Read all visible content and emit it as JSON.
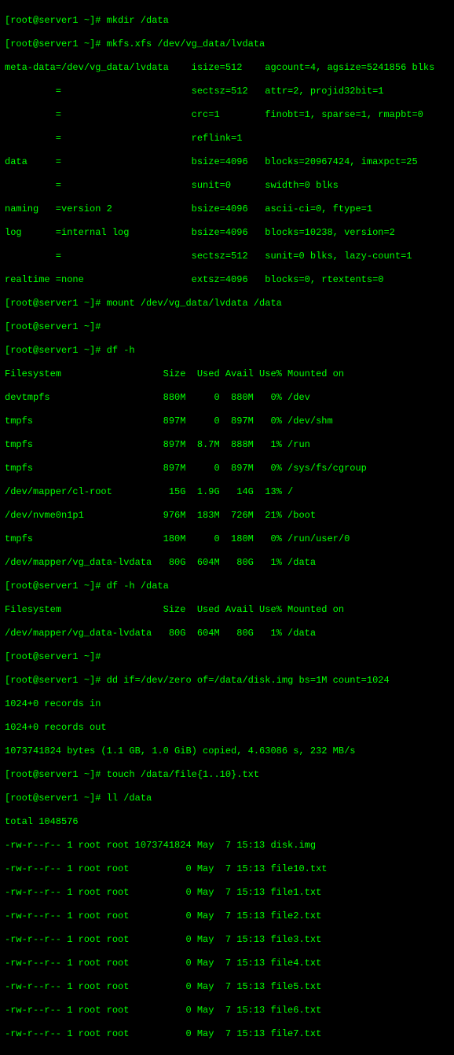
{
  "prompt": "[root@server1 ~]#",
  "cmds": {
    "mkdir": "mkdir /data",
    "mkfs": "mkfs.xfs /dev/vg_data/lvdata",
    "mount": "mount /dev/vg_data/lvdata /data",
    "dfh": "df -h",
    "dfh_data": "df -h /data",
    "dd": "dd if=/dev/zero of=/data/disk.img bs=1M count=1024",
    "touch": "touch /data/file{1..10}.txt",
    "ll": "ll /data"
  },
  "mkfs_out": [
    "meta-data=/dev/vg_data/lvdata    isize=512    agcount=4, agsize=5241856 blks",
    "         =                       sectsz=512   attr=2, projid32bit=1",
    "         =                       crc=1        finobt=1, sparse=1, rmapbt=0",
    "         =                       reflink=1",
    "data     =                       bsize=4096   blocks=20967424, imaxpct=25",
    "         =                       sunit=0      swidth=0 blks",
    "naming   =version 2              bsize=4096   ascii-ci=0, ftype=1",
    "log      =internal log           bsize=4096   blocks=10238, version=2",
    "         =                       sectsz=512   sunit=0 blks, lazy-count=1",
    "realtime =none                   extsz=4096   blocks=0, rtextents=0"
  ],
  "df_header": "Filesystem                  Size  Used Avail Use% Mounted on",
  "df_rows": [
    "devtmpfs                    880M     0  880M   0% /dev",
    "tmpfs                       897M     0  897M   0% /dev/shm",
    "tmpfs                       897M  8.7M  888M   1% /run",
    "tmpfs                       897M     0  897M   0% /sys/fs/cgroup",
    "/dev/mapper/cl-root          15G  1.9G   14G  13% /",
    "/dev/nvme0n1p1              976M  183M  726M  21% /boot",
    "tmpfs                       180M     0  180M   0% /run/user/0",
    "/dev/mapper/vg_data-lvdata   80G  604M   80G   1% /data"
  ],
  "df_data_rows": [
    "/dev/mapper/vg_data-lvdata   80G  604M   80G   1% /data"
  ],
  "dd_out": [
    "1024+0 records in",
    "1024+0 records out",
    "1073741824 bytes (1.1 GB, 1.0 GiB) copied, 4.63086 s, 232 MB/s"
  ],
  "ll_total": "total 1048576",
  "ll_rows": [
    "-rw-r--r-- 1 root root 1073741824 May  7 15:13 disk.img",
    "-rw-r--r-- 1 root root          0 May  7 15:13 file10.txt",
    "-rw-r--r-- 1 root root          0 May  7 15:13 file1.txt",
    "-rw-r--r-- 1 root root          0 May  7 15:13 file2.txt",
    "-rw-r--r-- 1 root root          0 May  7 15:13 file3.txt",
    "-rw-r--r-- 1 root root          0 May  7 15:13 file4.txt",
    "-rw-r--r-- 1 root root          0 May  7 15:13 file5.txt",
    "-rw-r--r-- 1 root root          0 May  7 15:13 file6.txt",
    "-rw-r--r-- 1 root root          0 May  7 15:13 file7.txt"
  ]
}
